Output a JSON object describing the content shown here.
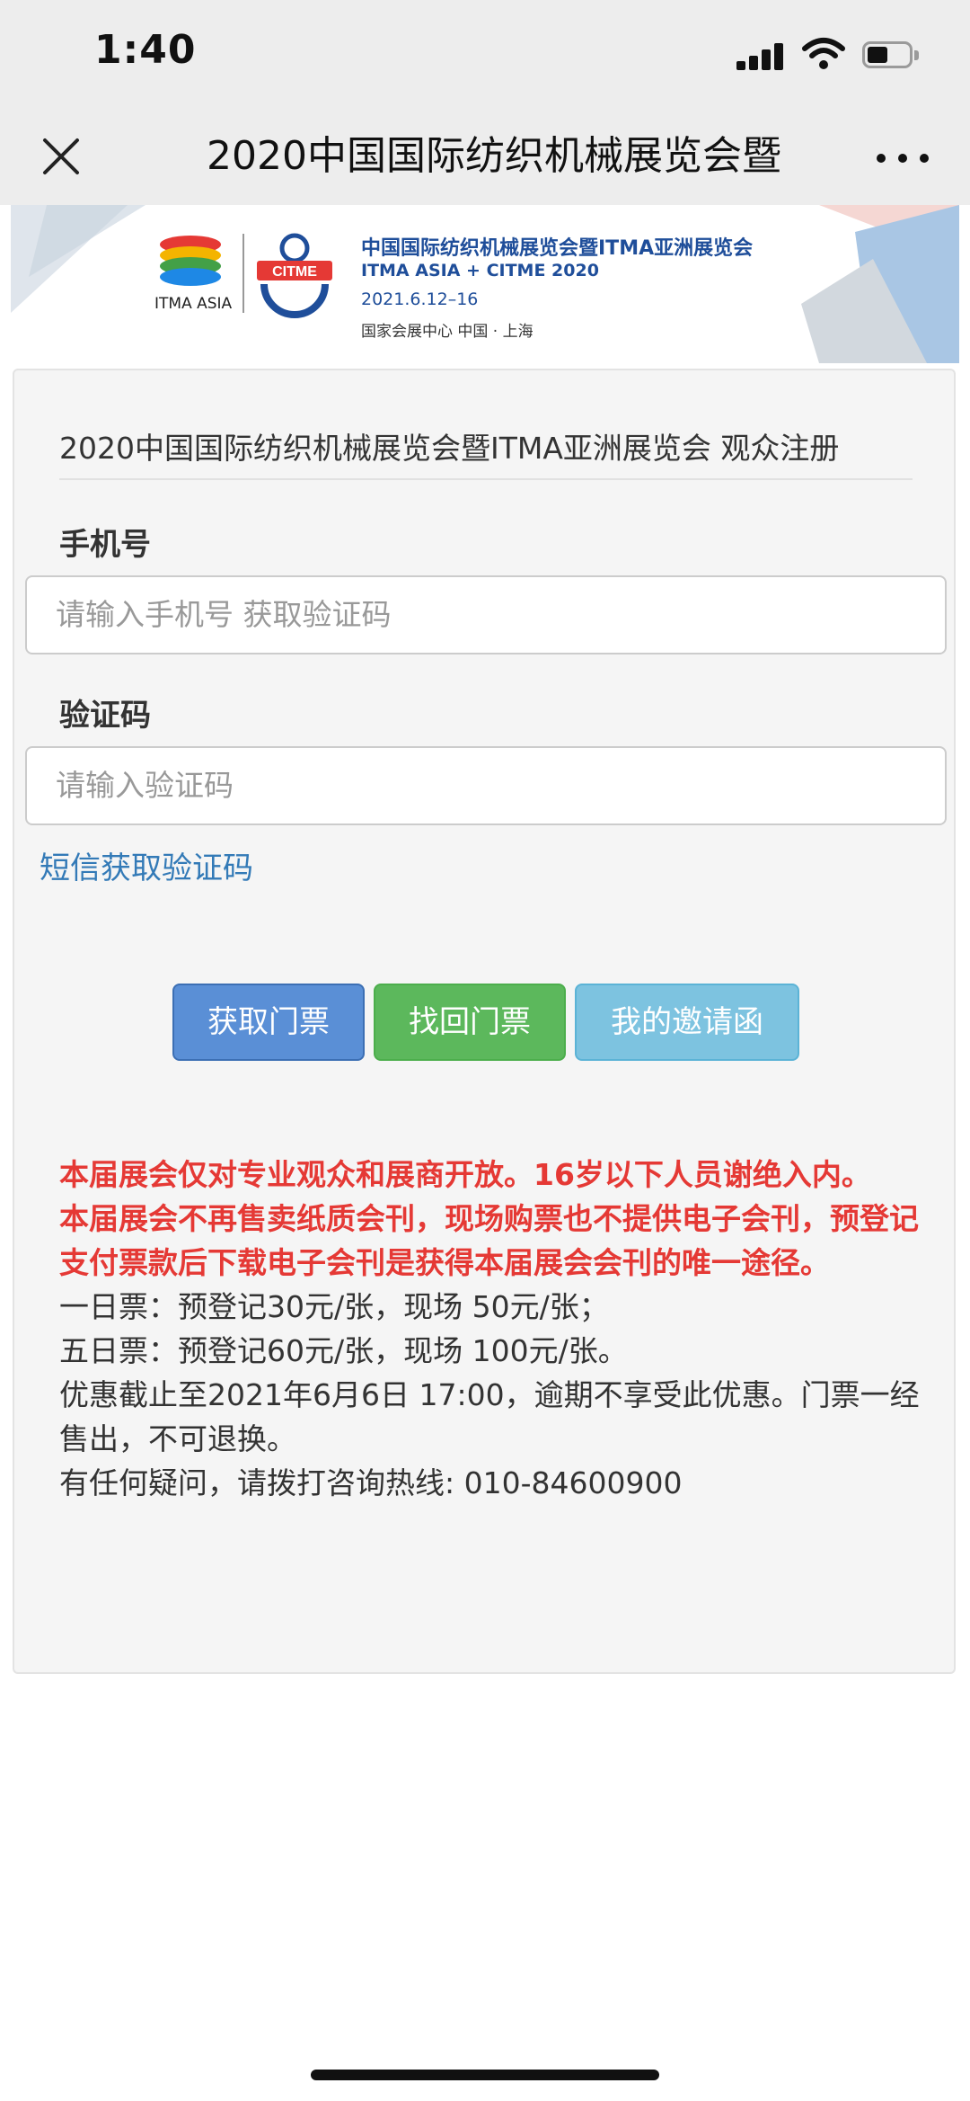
{
  "status": {
    "time": "1:40"
  },
  "nav": {
    "title": "2020中国国际纺织机械展览会暨"
  },
  "banner": {
    "title": "中国国际纺织机械展览会暨ITMA亚洲展览会",
    "subtitle": "ITMA ASIA + CITME 2020",
    "date": "2021.6.12–16",
    "venue": "国家会展中心  中国 · 上海",
    "itma_label": "ITMA ASIA",
    "citme_label": "CITME"
  },
  "form": {
    "title": "2020中国国际纺织机械展览会暨ITMA亚洲展览会 观众注册",
    "phone_label": "手机号",
    "phone_placeholder": "请输入手机号 获取验证码",
    "code_label": "验证码",
    "code_placeholder": "请输入验证码",
    "sms_link": "短信获取验证码"
  },
  "buttons": {
    "get_ticket": "获取门票",
    "recover_ticket": "找回门票",
    "my_invitation": "我的邀请函"
  },
  "notice": {
    "red_1": "本届展会仅对专业观众和展商开放。16岁以下人员谢绝入内。",
    "red_2": "本届展会不再售卖纸质会刊，现场购票也不提供电子会刊，预登记支付票款后下载电子会刊是获得本届展会会刊的唯一途径。",
    "line_1": "一日票：预登记30元/张，现场 50元/张；",
    "line_2": "五日票：预登记60元/张，现场 100元/张。",
    "line_3": "优惠截止至2021年6月6日 17:00，逾期不享受此优惠。门票一经售出，不可退换。",
    "line_4": "有任何疑问，请拨打咨询热线: 010-84600900"
  },
  "colors": {
    "primary": "#5a8fd6",
    "success": "#5cb85c",
    "info": "#7dc3e0",
    "warning_text": "#e53935",
    "link": "#337ab7"
  }
}
